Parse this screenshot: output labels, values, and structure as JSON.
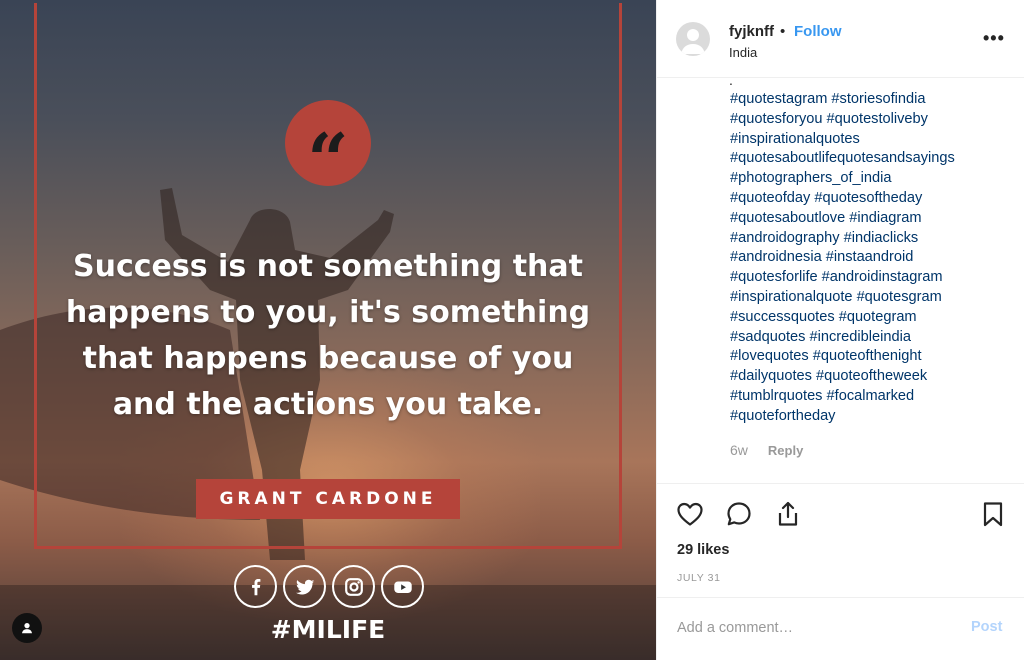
{
  "post": {
    "quote_mark": "“",
    "quote_text": "Success is not something that\nhappens to you, it's something\nthat happens because of you\nand the actions you take.",
    "author": "GRANT CARDONE",
    "brand_hashtag": "#MILIFE",
    "social_icons": [
      "facebook-icon",
      "twitter-icon",
      "instagram-icon",
      "youtube-icon"
    ],
    "accent_color": "#b5443a"
  },
  "header": {
    "username": "fyjknff",
    "separator": "•",
    "follow_label": "Follow",
    "location": "India",
    "more_label": "•••"
  },
  "comment": {
    "caption_fragment": ".",
    "hashtag_lines": [
      "#quotestagram #storiesofindia",
      "#quotesforyou #quotestoliveby",
      "#inspirationalquotes",
      "#quotesaboutlifequotesandsayings",
      "#photographers_of_india",
      "#quoteofday #quotesoftheday",
      "#quotesaboutlove #indiagram",
      "#androidography #indiaclicks",
      "#androidnesia #instaandroid",
      "#quotesforlife #androidinstagram",
      "#inspirationalquote #quotesgram",
      "#successquotes #quotegram",
      "#sadquotes #incredibleindia",
      "#lovequotes #quoteofthenight",
      "#dailyquotes #quoteoftheweek",
      "#tumblrquotes #focalmarked",
      "#quotefortheday"
    ],
    "time": "6w",
    "reply_label": "Reply"
  },
  "actions": {
    "likes": "29 likes",
    "date": "JULY 31"
  },
  "comment_box": {
    "placeholder": "Add a comment…",
    "post_label": "Post"
  },
  "colors": {
    "link_blue": "#3897f0",
    "hashtag_blue": "#003569",
    "muted": "#999999"
  }
}
